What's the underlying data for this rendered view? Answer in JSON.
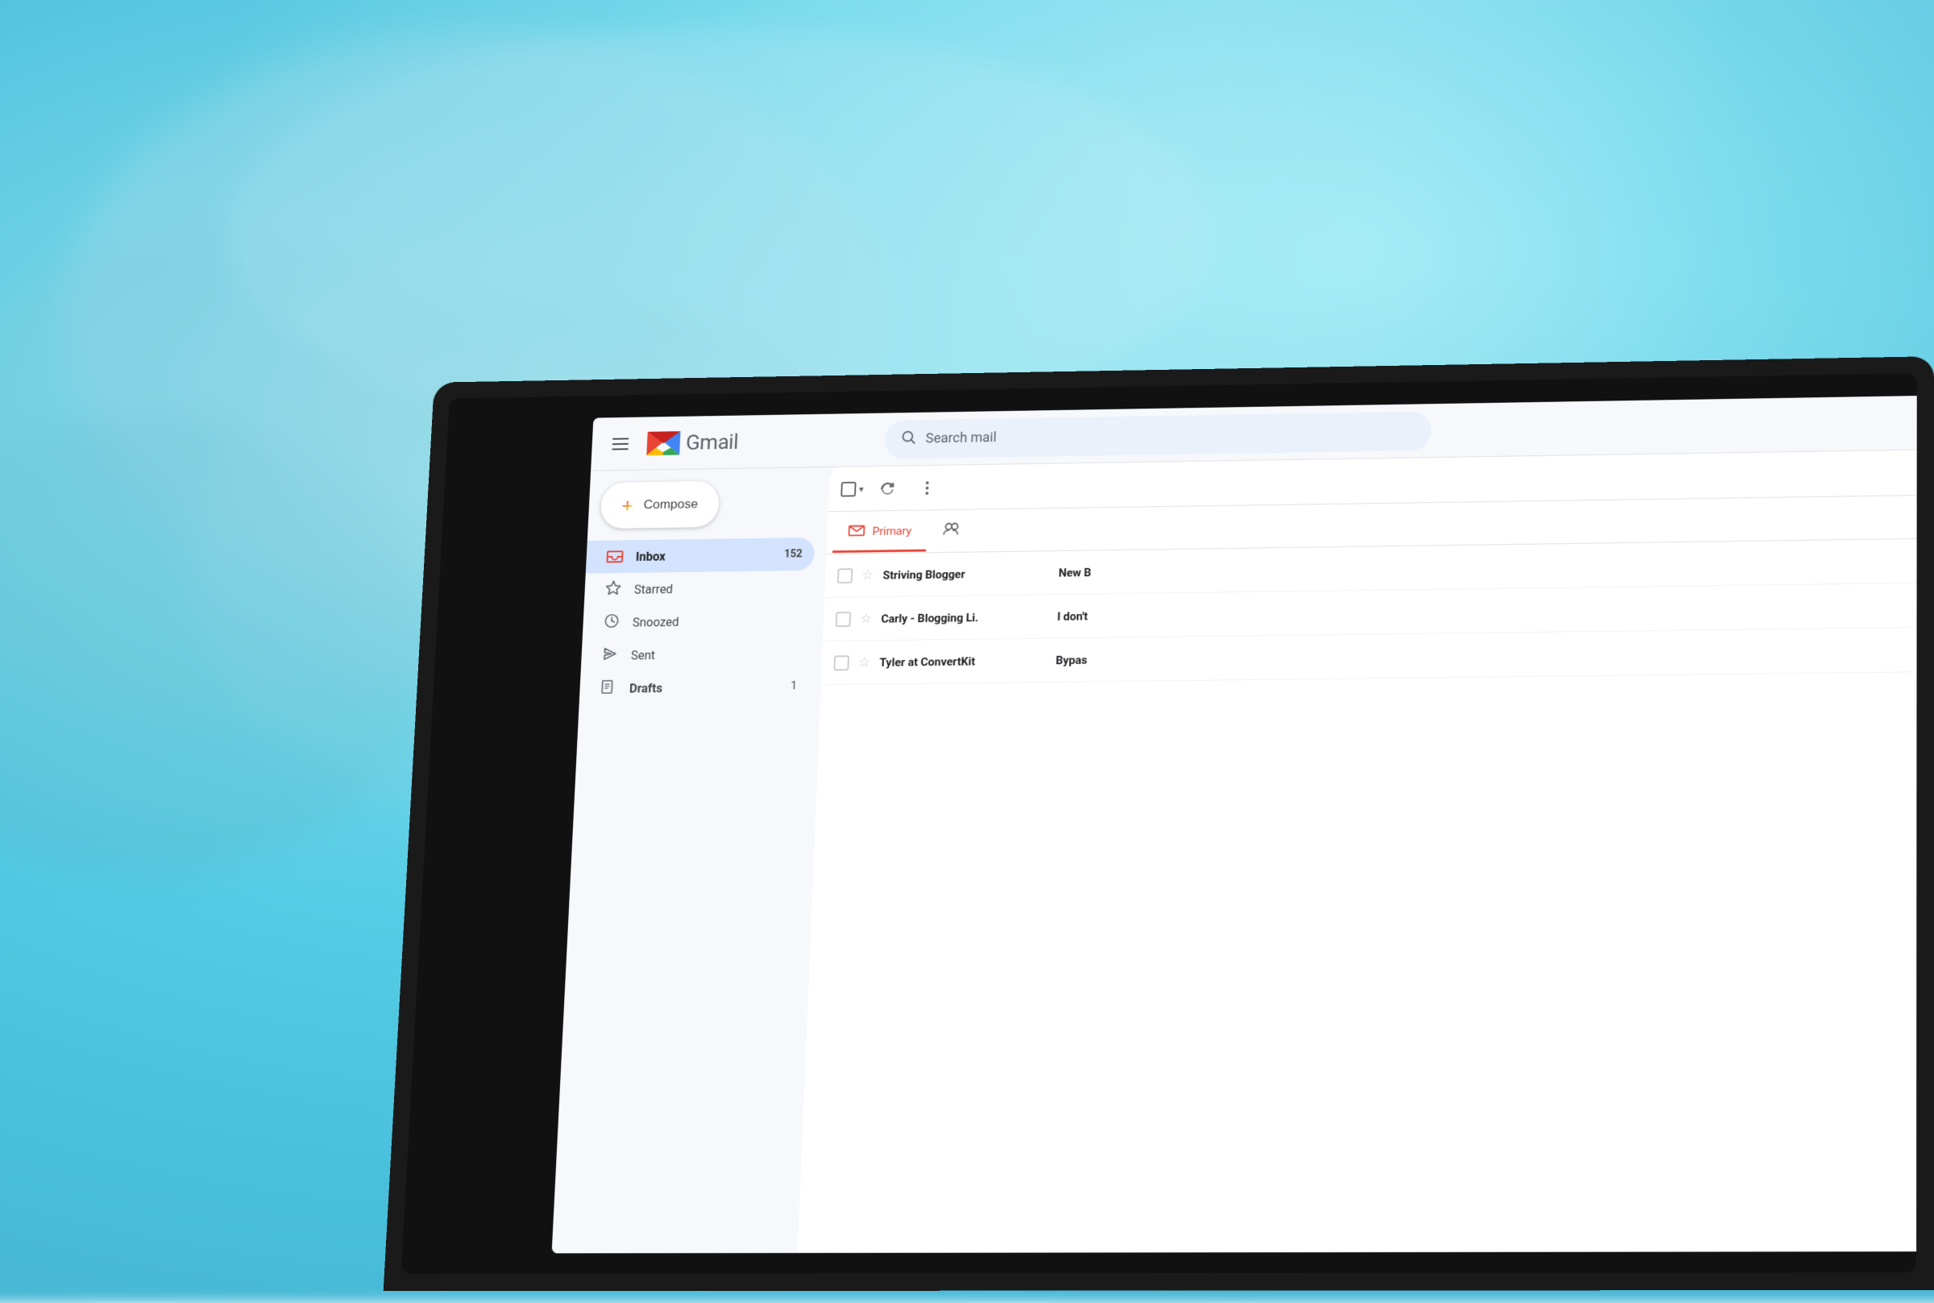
{
  "background": {
    "color_primary": "#2a7a9b",
    "color_secondary": "#1a5f7a"
  },
  "header": {
    "menu_label": "Main menu",
    "logo_text": "Gmail",
    "search": {
      "placeholder": "Search mail"
    }
  },
  "sidebar": {
    "compose_label": "Compose",
    "compose_plus": "+",
    "items": [
      {
        "id": "inbox",
        "label": "Inbox",
        "badge": "152",
        "active": true
      },
      {
        "id": "starred",
        "label": "Starred",
        "badge": "",
        "active": false
      },
      {
        "id": "snoozed",
        "label": "Snoozed",
        "badge": "",
        "active": false
      },
      {
        "id": "sent",
        "label": "Sent",
        "badge": "",
        "active": false
      },
      {
        "id": "drafts",
        "label": "Drafts",
        "badge": "1",
        "active": false
      }
    ]
  },
  "toolbar": {
    "select_all_label": "Select all",
    "refresh_label": "Refresh",
    "more_label": "More"
  },
  "tabs": [
    {
      "id": "primary",
      "label": "Primary",
      "active": true
    },
    {
      "id": "social",
      "label": "Social",
      "active": false
    }
  ],
  "emails": [
    {
      "sender": "Striving Blogger",
      "preview": "New B",
      "starred": false
    },
    {
      "sender": "Carly - Blogging Li.",
      "preview": "I don't",
      "starred": false
    },
    {
      "sender": "Tyler at ConvertKit",
      "preview": "Bypas",
      "starred": false
    }
  ]
}
